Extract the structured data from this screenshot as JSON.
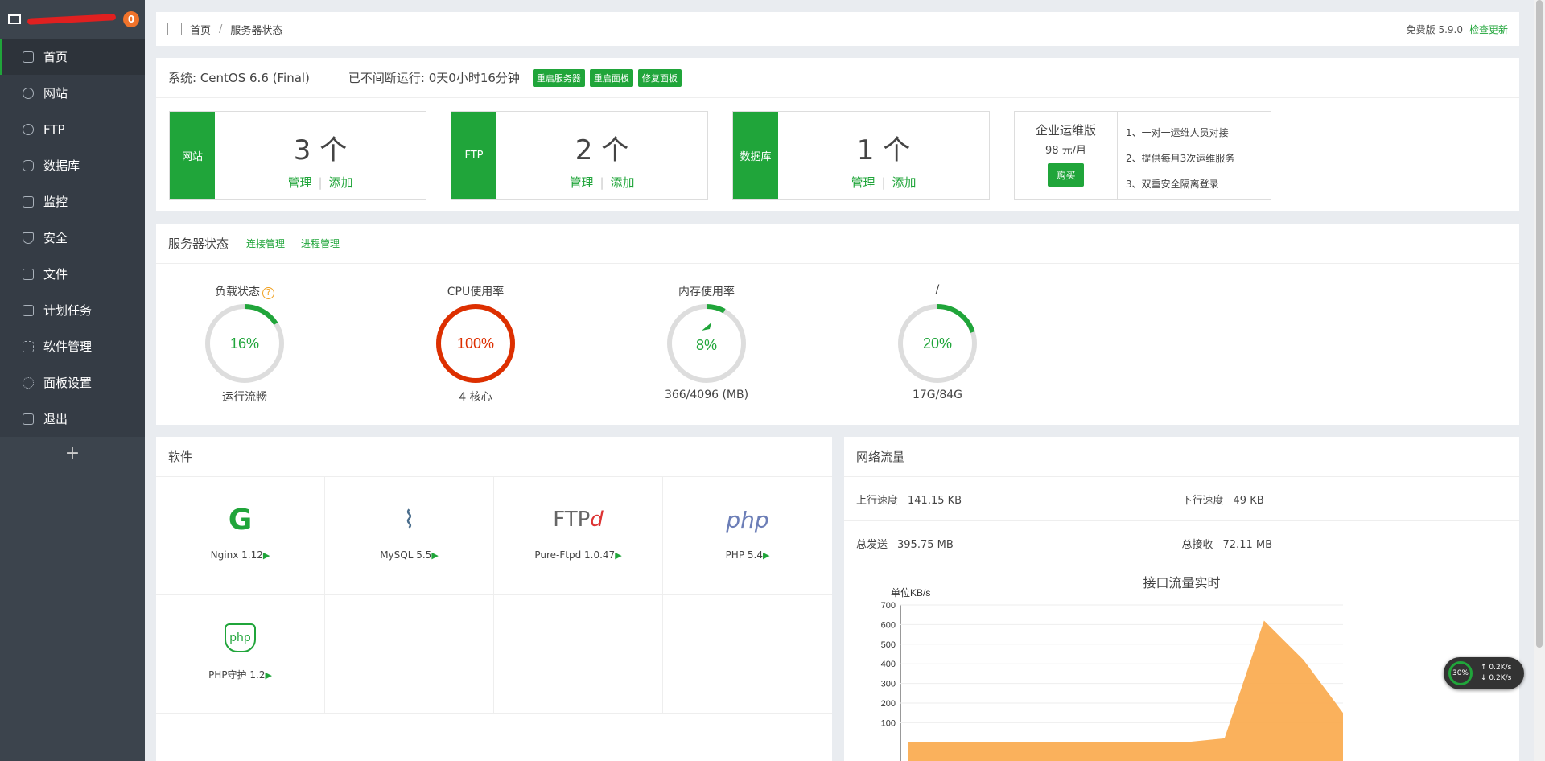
{
  "sidebar": {
    "badge": "0",
    "items": [
      {
        "label": "首页",
        "icon": "home-icon"
      },
      {
        "label": "网站",
        "icon": "globe-icon"
      },
      {
        "label": "FTP",
        "icon": "ftp-icon"
      },
      {
        "label": "数据库",
        "icon": "database-icon"
      },
      {
        "label": "监控",
        "icon": "monitor-icon"
      },
      {
        "label": "安全",
        "icon": "shield-icon"
      },
      {
        "label": "文件",
        "icon": "folder-icon"
      },
      {
        "label": "计划任务",
        "icon": "calendar-icon"
      },
      {
        "label": "软件管理",
        "icon": "grid-icon"
      },
      {
        "label": "面板设置",
        "icon": "gear-icon"
      },
      {
        "label": "退出",
        "icon": "logout-icon"
      }
    ],
    "add": "+"
  },
  "breadcrumb": {
    "home": "首页",
    "sep": "/",
    "current": "服务器状态"
  },
  "version": {
    "label": "免费版 5.9.0",
    "check": "检查更新"
  },
  "system": {
    "os": "系统: CentOS 6.6 (Final)",
    "uptime": "已不间断运行: 0天0小时16分钟",
    "buttons": [
      "重启服务器",
      "重启面板",
      "修复面板"
    ]
  },
  "stats": [
    {
      "label": "网站",
      "count": "3 个",
      "manage": "管理",
      "add": "添加"
    },
    {
      "label": "FTP",
      "count": "2 个",
      "manage": "管理",
      "add": "添加"
    },
    {
      "label": "数据库",
      "count": "1 个",
      "manage": "管理",
      "add": "添加"
    }
  ],
  "enterprise": {
    "title": "企业运维版",
    "price": "98 元/月",
    "buy": "购买",
    "features": [
      "1、一对一运维人员对接",
      "2、提供每月3次运维服务",
      "3、双重安全隔离登录"
    ]
  },
  "server": {
    "title": "服务器状态",
    "links": [
      "连接管理",
      "进程管理"
    ],
    "gauges": [
      {
        "title": "负载状态",
        "value": "16%",
        "pct": 16,
        "sub": "运行流畅",
        "color": "#20a53a"
      },
      {
        "title": "CPU使用率",
        "value": "100%",
        "pct": 100,
        "sub": "4 核心",
        "color": "#dd2f00"
      },
      {
        "title": "内存使用率",
        "value": "8%",
        "pct": 8,
        "sub": "366/4096 (MB)",
        "color": "#20a53a"
      },
      {
        "title": "/",
        "value": "20%",
        "pct": 20,
        "sub": "17G/84G",
        "color": "#20a53a"
      }
    ]
  },
  "software": {
    "title": "软件",
    "items": [
      {
        "name": "Nginx 1.12",
        "icon": "nginx-icon"
      },
      {
        "name": "MySQL 5.5",
        "icon": "mysql-dolphin-icon"
      },
      {
        "name": "Pure-Ftpd 1.0.47",
        "icon": "ftpd-icon"
      },
      {
        "name": "PHP 5.4",
        "icon": "php-icon"
      },
      {
        "name": "PHP守护 1.2",
        "icon": "php-shield-icon"
      }
    ]
  },
  "network": {
    "title": "网络流量",
    "up_label": "上行速度",
    "up": "141.15 KB",
    "down_label": "下行速度",
    "down": "49 KB",
    "sent_label": "总发送",
    "sent": "395.75 MB",
    "recv_label": "总接收",
    "recv": "72.11 MB"
  },
  "chart_data": {
    "type": "area",
    "title": "接口流量实时",
    "ylabel": "单位KB/s",
    "ylim": [
      0,
      700
    ],
    "yticks": [
      "700",
      "600",
      "500",
      "400",
      "300",
      "200",
      "100"
    ],
    "x": [
      0,
      1,
      2,
      3,
      4,
      5,
      6,
      7,
      8,
      9,
      10,
      11
    ],
    "series": [
      {
        "color": "#f9a94a",
        "values": [
          0,
          0,
          0,
          0,
          0,
          0,
          0,
          0,
          20,
          620,
          420,
          150
        ]
      }
    ]
  },
  "float_widget": {
    "pct": "30%",
    "up": "0.2K/s",
    "down": "0.2K/s"
  }
}
